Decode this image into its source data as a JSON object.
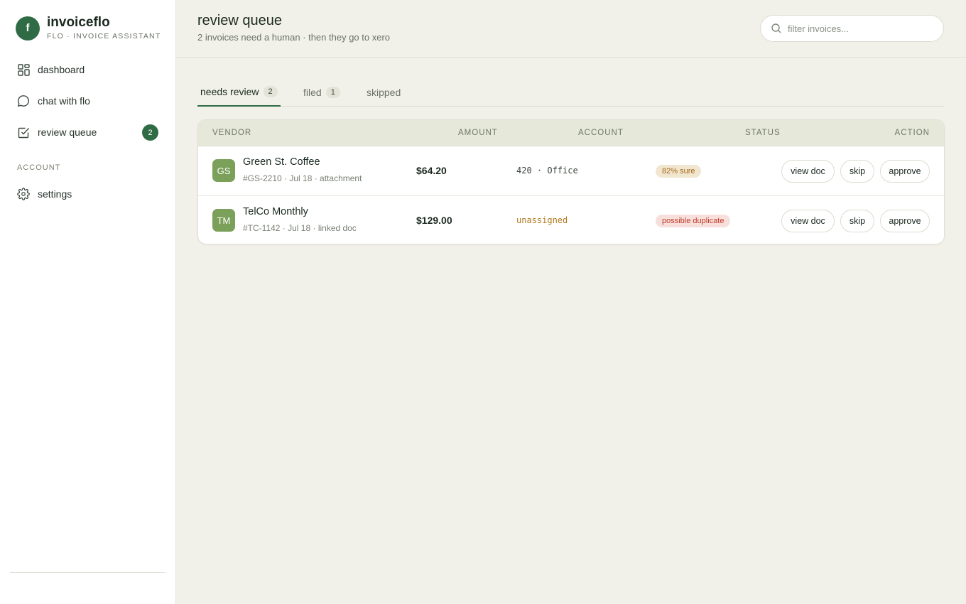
{
  "brand": {
    "logo_letter": "f",
    "name": "invoiceflo",
    "subtitle": "FLO · INVOICE ASSISTANT"
  },
  "sidebar": {
    "items": [
      {
        "label": "dashboard",
        "icon": "dashboard-icon"
      },
      {
        "label": "chat with flo",
        "icon": "chat-icon"
      },
      {
        "label": "review queue",
        "icon": "checkbox-icon",
        "badge": "2"
      }
    ],
    "section_label": "ACCOUNT",
    "account_items": [
      {
        "label": "settings",
        "icon": "gear-icon"
      }
    ]
  },
  "header": {
    "title": "review queue",
    "subtitle": "2 invoices need a human · then they go to xero",
    "search_placeholder": "filter invoices..."
  },
  "tabs": [
    {
      "label": "needs review",
      "count": "2",
      "active": true
    },
    {
      "label": "filed",
      "count": "1",
      "active": false
    },
    {
      "label": "skipped",
      "count": null,
      "active": false
    }
  ],
  "table": {
    "columns": [
      "VENDOR",
      "AMOUNT",
      "ACCOUNT",
      "STATUS",
      "ACTION"
    ],
    "rows": [
      {
        "initials": "GS",
        "vendor": "Green St. Coffee",
        "meta": "#GS-2210 · Jul 18 · attachment",
        "amount": "$64.20",
        "account": "420 · Office",
        "status": "82% sure",
        "actions": {
          "view": "view doc",
          "skip": "skip",
          "approve": "approve"
        }
      },
      {
        "initials": "TM",
        "vendor": "TelCo Monthly",
        "meta": "#TC-1142 · Jul 18 · linked doc",
        "amount": "$129.00",
        "account": "unassigned",
        "status": "possible duplicate",
        "actions": {
          "view": "view doc",
          "skip": "skip",
          "approve": "approve"
        }
      }
    ]
  },
  "colors": {
    "accent": "#2f6b45",
    "avatar": "#7aa05a",
    "background": "#f1f1e9",
    "status_sure_bg": "#f1e6cf",
    "status_sure_fg": "#a4681b",
    "status_dup_bg": "#f7dfdc",
    "status_dup_fg": "#c0392b",
    "unassigned": "#b0781e"
  }
}
